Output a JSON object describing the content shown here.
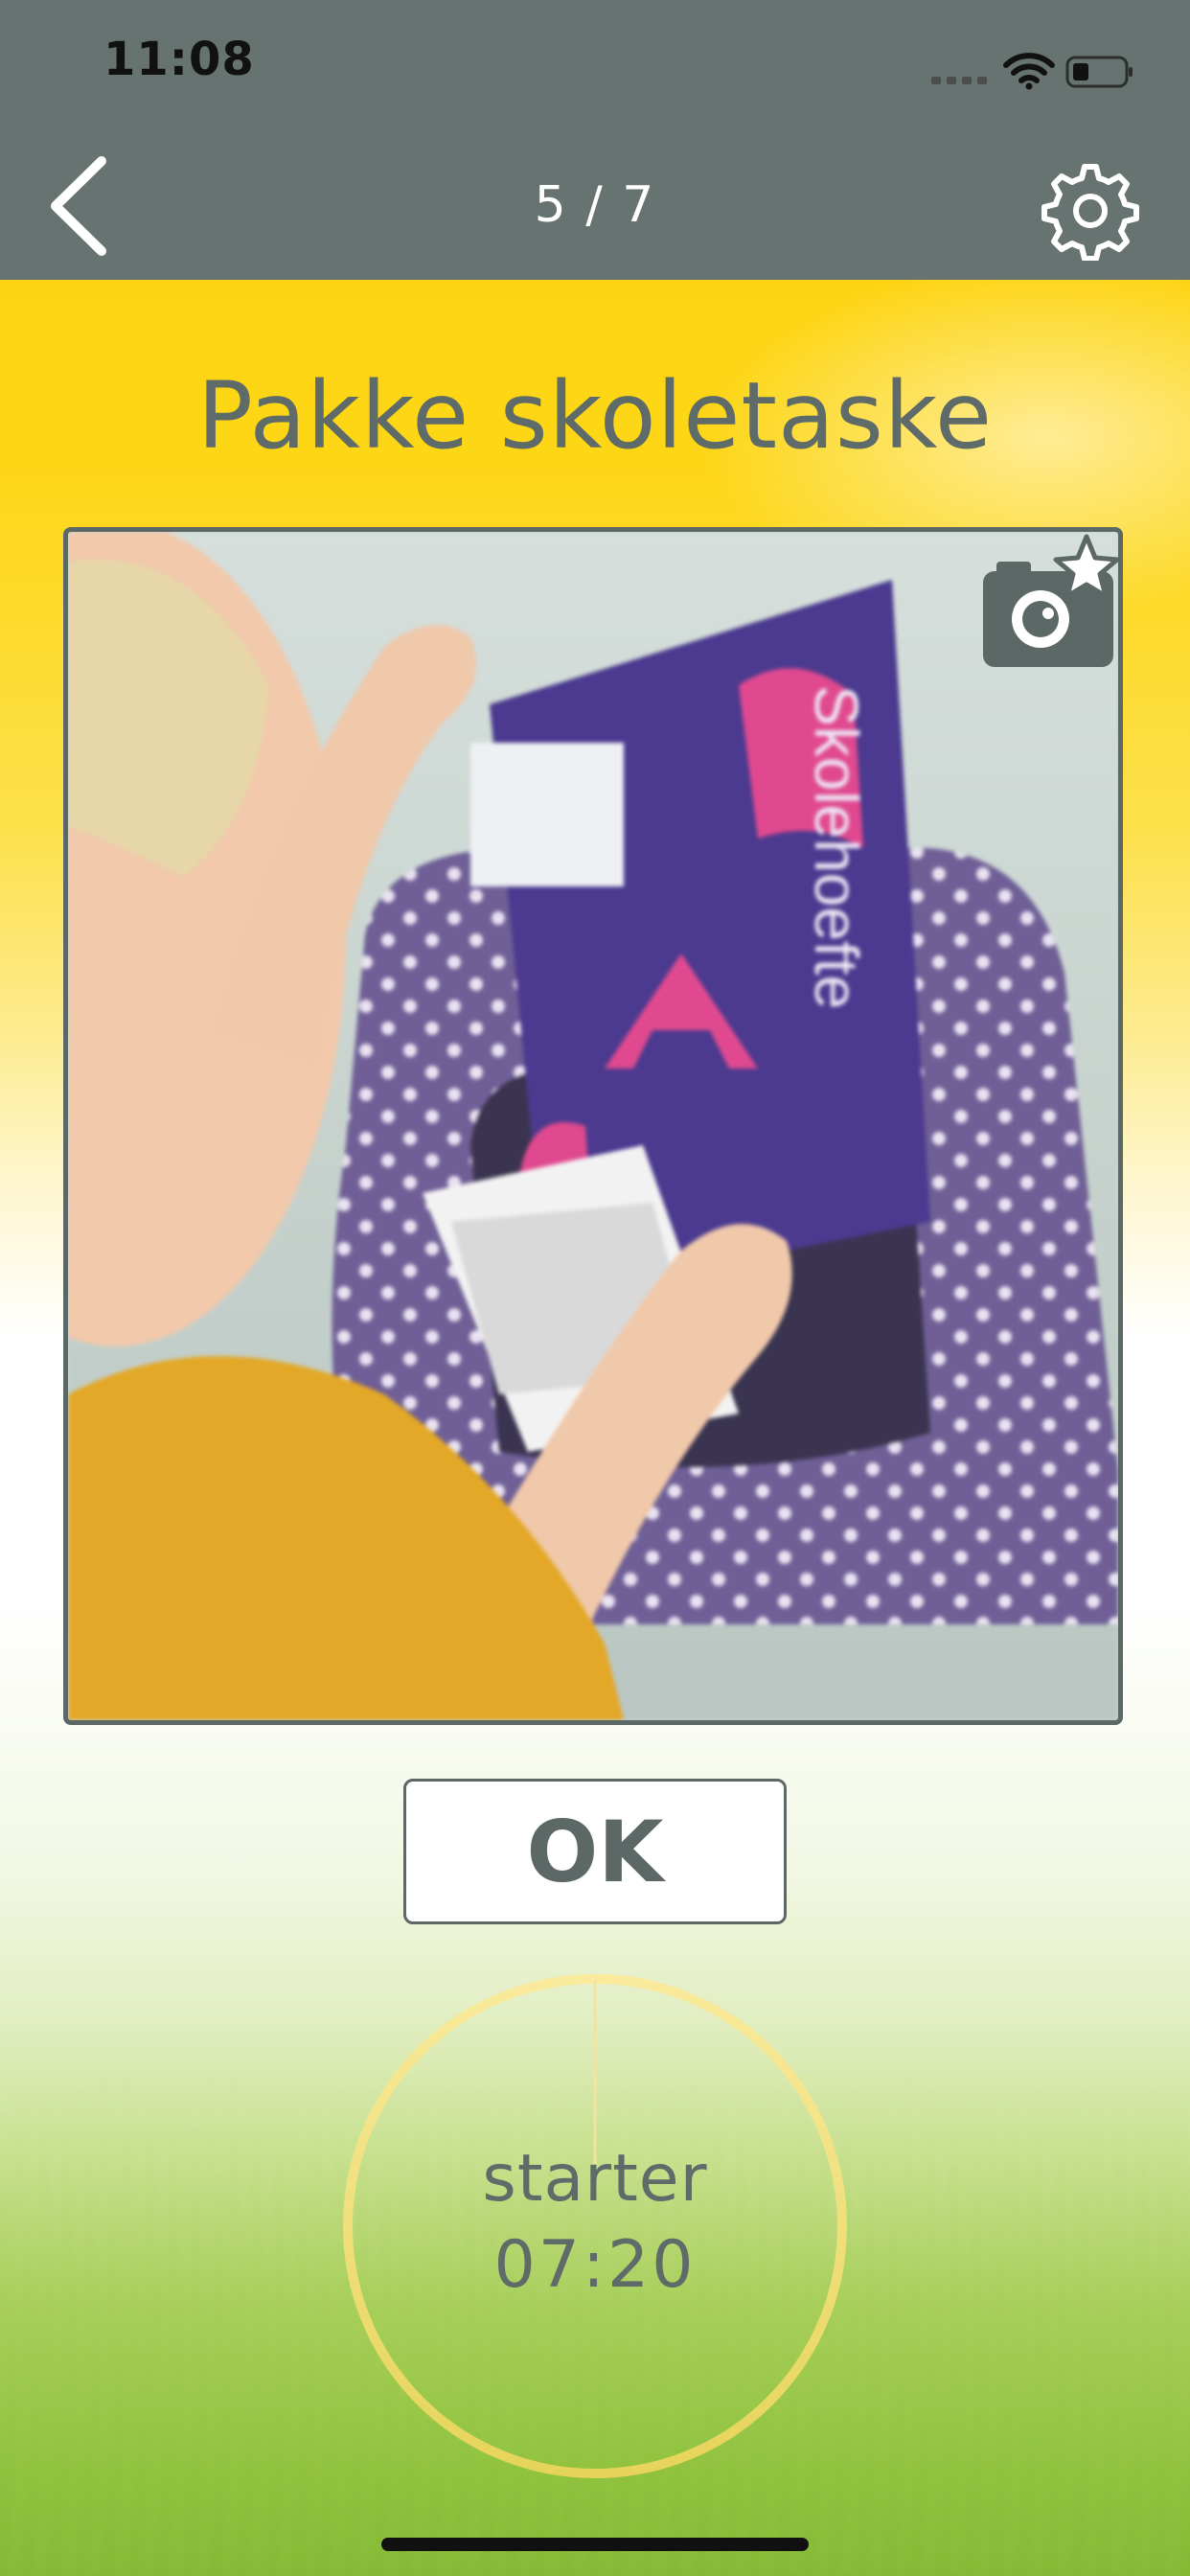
{
  "status_bar": {
    "time": "11:08",
    "icons": [
      "cellular-signal-icon",
      "wifi-icon",
      "battery-icon"
    ]
  },
  "nav": {
    "back_icon": "chevron-left-icon",
    "counter": "5 / 7",
    "settings_icon": "gear-icon"
  },
  "task": {
    "title": "Pakke skoletaske",
    "camera_icon": "camera-star-icon"
  },
  "actions": {
    "ok_label": "OK"
  },
  "timer": {
    "label": "starter",
    "time": "07:20"
  },
  "colors": {
    "header_bg": "#667370",
    "accent_yellow": "#fdd20e",
    "text_gray": "#5f6b68",
    "timer_ring": "#f7e690"
  }
}
